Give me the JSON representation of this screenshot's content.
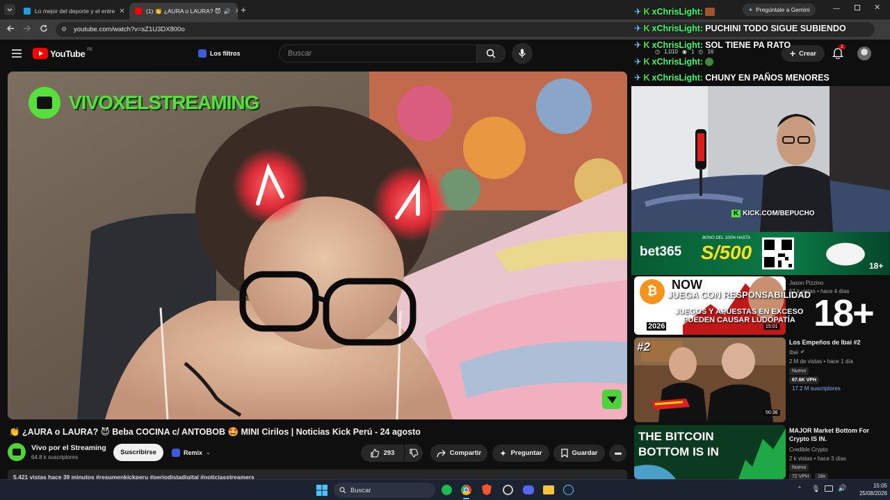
{
  "browser": {
    "tabs": [
      {
        "label": "Lo mejor del deporte y el entre",
        "active": false
      },
      {
        "label": "(1) 👏 ¿AURA o LAURA? 😈",
        "active": true
      }
    ],
    "url": "youtube.com/watch?v=sZ1U3DX800o",
    "gemini_label": "Pregúntale a Gemini"
  },
  "youtube": {
    "logo_text": "YouTube",
    "region": "PE",
    "filters_label": "Los filtros",
    "search_placeholder": "Buscar",
    "create_label": "Crear",
    "notifications_count": "1",
    "toolbar_stats": {
      "viewers": "1,010",
      "a": "1",
      "b": "16"
    }
  },
  "video": {
    "overlay_channel": "VIVOXELSTREAMING",
    "title": "👏 ¿AURA o LAURA? 😈 Beba COCINA c/ ANTOBOB 🤩 MINI Cirilos | Noticias Kick Perú - 24 agosto",
    "channel_name": "Vivo por el Streaming",
    "subscribers": "64.8 k suscriptores",
    "subscribe_label": "Suscribirse",
    "remix_label": "Remix",
    "likes": "293",
    "share_label": "Compartir",
    "ask_label": "Preguntar",
    "save_label": "Guardar",
    "meta_line": "5.421 vistas  hace 39 minutos  #resumenkickperu  #periodistadigital  #noticiasstreamers"
  },
  "chat": [
    {
      "user": "xChrisLight:",
      "message": ""
    },
    {
      "user": "xChrisLight:",
      "message": "PUCHINI TODO SIGUE SUBIENDO"
    },
    {
      "user": "xChrisLight:",
      "message": "SOL TIENE PA RATO"
    },
    {
      "user": "xChrisLight:",
      "message": ""
    },
    {
      "user": "xChrisLight:",
      "message": "CHUNY EN PAÑOS MENORES"
    }
  ],
  "streamer_overlay": {
    "kick_url": "KICK.COM/BEPUCHO",
    "ad_brand": "bet365",
    "ad_bonus_text": "BONO DEL 100% HASTA",
    "ad_amount": "S/500",
    "ad_age": "18+",
    "disclaimer_lines": [
      "JUEGA CON RESPONSABILIDAD",
      "JUEGOS Y APUESTAS EN EXCESO",
      "PUEDEN CAUSAR LUDOPATÍA"
    ],
    "big_age": "18+"
  },
  "recommendations": [
    {
      "thumb_text": "NOW",
      "thumb_year": "2026",
      "title": "",
      "channel": "Jason Pizzino",
      "meta": "57 k vistas • hace 4 días",
      "badge": "Nuevo",
      "duration": "15:01"
    },
    {
      "thumb_text": "#2",
      "title": "Los Empeños de Ibai #2",
      "channel": "Ibai",
      "meta": "2 M de vistas • hace 1 día",
      "badge": "Nuevo",
      "vph": "67.6K VPH",
      "subs_hint": "17.2 M suscriptores",
      "duration": "50:36"
    },
    {
      "thumb_text": "THE BITCOIN BOTTOM IS IN",
      "title": "MAJOR Market Bottom For Crypto IS IN.",
      "channel": "Credible Crypto",
      "meta": "2 k vistas • hace 3 días",
      "badge": "Nuevo",
      "vph": "72 VPH",
      "ratio": "18x"
    }
  ],
  "taskbar": {
    "search_label": "Buscar",
    "time": "15:05",
    "date": "25/08/2026"
  },
  "colors": {
    "youtube_red": "#ff0000",
    "chat_user": "#39ff6a",
    "bet365_green": "#0b6b3a",
    "bet365_yellow": "#ffdf1b"
  }
}
